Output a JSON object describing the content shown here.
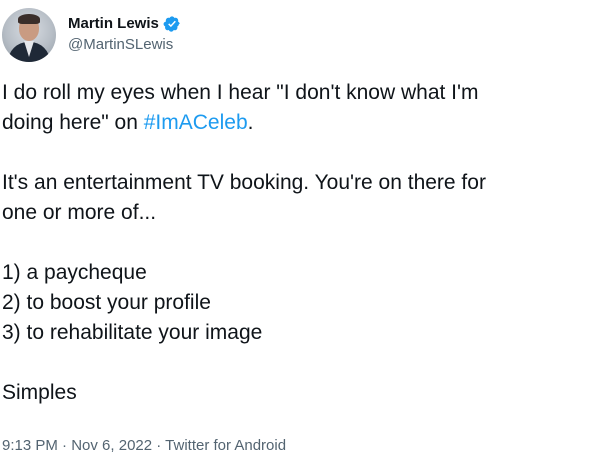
{
  "author": {
    "name": "Martin Lewis",
    "handle": "@MartinSLewis",
    "verified_color": "#1d9bf0"
  },
  "tweet": {
    "line1": "I do roll my eyes when I hear \"I don't know what I'm",
    "line2_prefix": "doing here\" on ",
    "hashtag": "#ImACeleb",
    "line2_suffix": ".",
    "line3": "It's an entertainment TV booking. You're on there for",
    "line4": "one or more of...",
    "item1": "1) a paycheque",
    "item2": "2) to boost your profile",
    "item3": "3) to rehabilitate your image",
    "closing": "Simples"
  },
  "meta": {
    "time": "9:13 PM",
    "separator": " · ",
    "date": "Nov 6, 2022",
    "source": "Twitter for Android"
  },
  "colors": {
    "text": "#0f1419",
    "secondary": "#536471",
    "link": "#1d9bf0"
  }
}
